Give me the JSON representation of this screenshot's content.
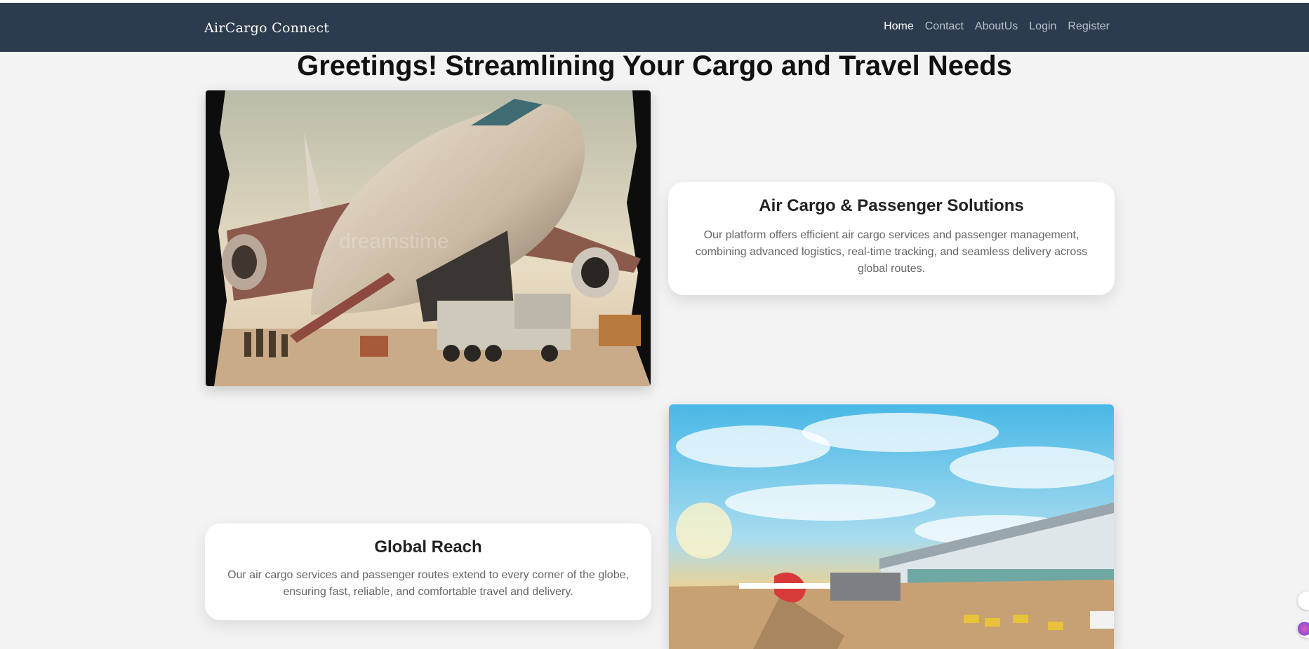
{
  "nav": {
    "brand": "AirCargo Connect",
    "links": [
      {
        "label": "Home",
        "active": true
      },
      {
        "label": "Contact",
        "active": false
      },
      {
        "label": "AboutUs",
        "active": false
      },
      {
        "label": "Login",
        "active": false
      },
      {
        "label": "Register",
        "active": false
      }
    ]
  },
  "hero": {
    "title": "Greetings! Streamlining Your Cargo and Travel Needs"
  },
  "sections": [
    {
      "title": "Air Cargo & Passenger Solutions",
      "text": "Our platform offers efficient air cargo services and passenger management, combining advanced logistics, real-time tracking, and seamless delivery across global routes.",
      "image": "cargo-plane-loading-image"
    },
    {
      "title": "Global Reach",
      "text": "Our air cargo services and passenger routes extend to every corner of the globe, ensuring fast, reliable, and comfortable travel and delivery.",
      "image": "airport-terminal-image"
    }
  ],
  "colors": {
    "navbar": "#2c3b4d",
    "background": "#f3f3f3",
    "card": "#ffffff"
  }
}
